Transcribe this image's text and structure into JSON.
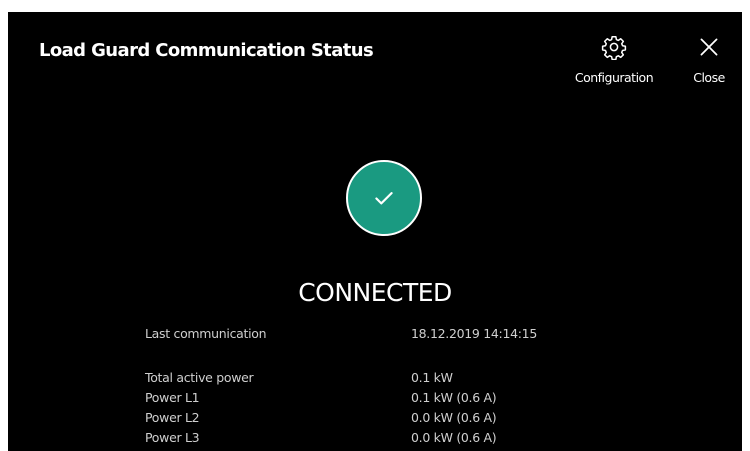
{
  "header": {
    "title": "Load Guard Communication Status",
    "configuration_label": "Configuration",
    "close_label": "Close"
  },
  "status": {
    "text": "CONNECTED",
    "color": "#1a9a81",
    "icon": "check-icon"
  },
  "last_communication": {
    "label": "Last communication",
    "value": "18.12.2019 14:14:15"
  },
  "power": [
    {
      "label": "Total active power",
      "value": "0.1 kW"
    },
    {
      "label": "Power L1",
      "value": "0.1 kW (0.6 A)"
    },
    {
      "label": "Power L2",
      "value": "0.0 kW (0.6 A)"
    },
    {
      "label": "Power L3",
      "value": "0.0 kW (0.6 A)"
    }
  ]
}
